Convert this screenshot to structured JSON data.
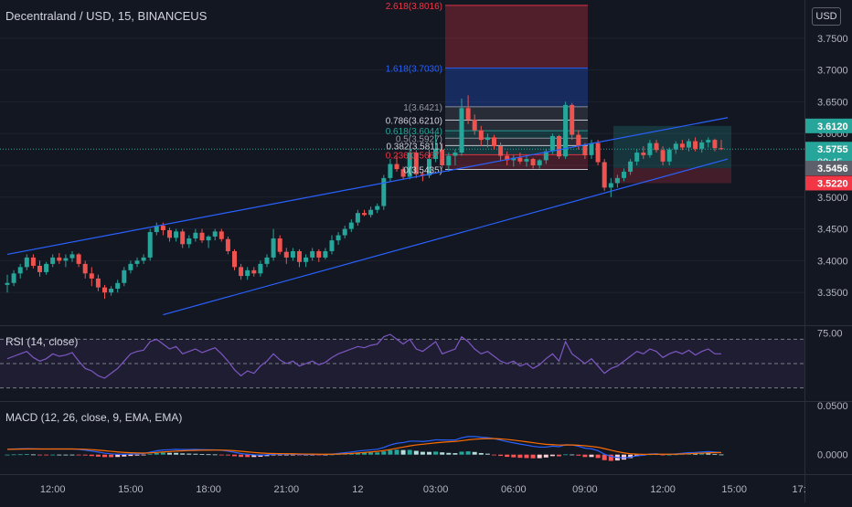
{
  "header": {
    "symbol_title": "Decentraland / USD, 15, BINANCEUS",
    "currency": "USD",
    "rsi_title": "RSI (14, close)",
    "macd_title": "MACD (12, 26, close, 9, EMA, EMA)"
  },
  "colors": {
    "background": "#131722",
    "up": "#26a69a",
    "down": "#ef5350",
    "channel": "#2962ff",
    "rsi_line": "#7e57c2",
    "macd_line": "#2962ff",
    "signal_line": "#ff6d00",
    "axis_text": "#b2b5be",
    "price_badge": "#26a69a",
    "low_badge": "#f23645",
    "gray_badge": "#5d606b"
  },
  "chart_data": {
    "type": "candlestick",
    "price_axis": {
      "range": [
        3.3,
        3.81
      ],
      "ticks": [
        "3.3500",
        "3.4000",
        "3.4500",
        "3.5000",
        "3.5500",
        "3.6000",
        "3.6500",
        "3.7000",
        "3.7500"
      ]
    },
    "time_axis": {
      "tick_labels": [
        "12:00",
        "15:00",
        "18:00",
        "21:00",
        "12",
        "03:00",
        "06:00",
        "09:00",
        "12:00",
        "15:00",
        "17:"
      ]
    },
    "candles": [
      [
        3.362,
        3.378,
        3.35,
        3.365
      ],
      [
        3.365,
        3.385,
        3.36,
        3.38
      ],
      [
        3.38,
        3.395,
        3.372,
        3.39
      ],
      [
        3.39,
        3.41,
        3.385,
        3.405
      ],
      [
        3.405,
        3.41,
        3.388,
        3.392
      ],
      [
        3.392,
        3.4,
        3.375,
        3.382
      ],
      [
        3.382,
        3.398,
        3.378,
        3.395
      ],
      [
        3.395,
        3.41,
        3.39,
        3.405
      ],
      [
        3.405,
        3.412,
        3.395,
        3.4
      ],
      [
        3.4,
        3.41,
        3.39,
        3.404
      ],
      [
        3.404,
        3.415,
        3.398,
        3.41
      ],
      [
        3.41,
        3.412,
        3.39,
        3.395
      ],
      [
        3.395,
        3.4,
        3.372,
        3.38
      ],
      [
        3.38,
        3.39,
        3.36,
        3.372
      ],
      [
        3.372,
        3.378,
        3.352,
        3.358
      ],
      [
        3.358,
        3.362,
        3.34,
        3.35
      ],
      [
        3.35,
        3.36,
        3.345,
        3.356
      ],
      [
        3.356,
        3.37,
        3.35,
        3.365
      ],
      [
        3.365,
        3.39,
        3.36,
        3.385
      ],
      [
        3.385,
        3.4,
        3.38,
        3.395
      ],
      [
        3.395,
        3.405,
        3.39,
        3.4
      ],
      [
        3.4,
        3.41,
        3.395,
        3.405
      ],
      [
        3.405,
        3.45,
        3.4,
        3.445
      ],
      [
        3.445,
        3.46,
        3.44,
        3.455
      ],
      [
        3.455,
        3.46,
        3.44,
        3.448
      ],
      [
        3.448,
        3.452,
        3.43,
        3.436
      ],
      [
        3.436,
        3.45,
        3.43,
        3.446
      ],
      [
        3.446,
        3.45,
        3.42,
        3.426
      ],
      [
        3.426,
        3.44,
        3.42,
        3.435
      ],
      [
        3.435,
        3.45,
        3.43,
        3.444
      ],
      [
        3.444,
        3.45,
        3.428,
        3.432
      ],
      [
        3.432,
        3.44,
        3.42,
        3.438
      ],
      [
        3.438,
        3.45,
        3.432,
        3.446
      ],
      [
        3.446,
        3.45,
        3.43,
        3.434
      ],
      [
        3.434,
        3.438,
        3.41,
        3.415
      ],
      [
        3.415,
        3.418,
        3.385,
        3.39
      ],
      [
        3.39,
        3.395,
        3.37,
        3.376
      ],
      [
        3.376,
        3.39,
        3.37,
        3.385
      ],
      [
        3.385,
        3.39,
        3.375,
        3.38
      ],
      [
        3.38,
        3.4,
        3.375,
        3.395
      ],
      [
        3.395,
        3.41,
        3.39,
        3.405
      ],
      [
        3.405,
        3.45,
        3.4,
        3.435
      ],
      [
        3.435,
        3.44,
        3.41,
        3.414
      ],
      [
        3.414,
        3.42,
        3.395,
        3.405
      ],
      [
        3.405,
        3.42,
        3.4,
        3.415
      ],
      [
        3.415,
        3.418,
        3.39,
        3.398
      ],
      [
        3.398,
        3.41,
        3.39,
        3.405
      ],
      [
        3.405,
        3.42,
        3.4,
        3.415
      ],
      [
        3.415,
        3.418,
        3.398,
        3.405
      ],
      [
        3.405,
        3.42,
        3.402,
        3.415
      ],
      [
        3.415,
        3.44,
        3.41,
        3.432
      ],
      [
        3.432,
        3.445,
        3.425,
        3.44
      ],
      [
        3.44,
        3.455,
        3.435,
        3.45
      ],
      [
        3.45,
        3.465,
        3.445,
        3.46
      ],
      [
        3.46,
        3.48,
        3.455,
        3.475
      ],
      [
        3.475,
        3.48,
        3.47,
        3.472
      ],
      [
        3.472,
        3.485,
        3.468,
        3.48
      ],
      [
        3.48,
        3.49,
        3.475,
        3.486
      ],
      [
        3.486,
        3.535,
        3.48,
        3.53
      ],
      [
        3.53,
        3.56,
        3.525,
        3.552
      ],
      [
        3.552,
        3.565,
        3.54,
        3.544
      ],
      [
        3.544,
        3.548,
        3.528,
        3.532
      ],
      [
        3.532,
        3.575,
        3.528,
        3.57
      ],
      [
        3.57,
        3.574,
        3.53,
        3.536
      ],
      [
        3.536,
        3.54,
        3.525,
        3.534
      ],
      [
        3.534,
        3.575,
        3.53,
        3.56
      ],
      [
        3.56,
        3.6,
        3.555,
        3.575
      ],
      [
        3.575,
        3.585,
        3.545,
        3.55
      ],
      [
        3.55,
        3.57,
        3.54,
        3.565
      ],
      [
        3.565,
        3.575,
        3.55,
        3.57
      ],
      [
        3.57,
        3.655,
        3.565,
        3.64
      ],
      [
        3.64,
        3.66,
        3.615,
        3.622
      ],
      [
        3.622,
        3.63,
        3.598,
        3.605
      ],
      [
        3.605,
        3.612,
        3.58,
        3.59
      ],
      [
        3.59,
        3.6,
        3.578,
        3.594
      ],
      [
        3.594,
        3.598,
        3.575,
        3.58
      ],
      [
        3.58,
        3.586,
        3.558,
        3.565
      ],
      [
        3.565,
        3.572,
        3.55,
        3.558
      ],
      [
        3.558,
        3.566,
        3.548,
        3.562
      ],
      [
        3.562,
        3.57,
        3.552,
        3.556
      ],
      [
        3.556,
        3.565,
        3.548,
        3.56
      ],
      [
        3.56,
        3.562,
        3.545,
        3.55
      ],
      [
        3.55,
        3.56,
        3.545,
        3.558
      ],
      [
        3.558,
        3.576,
        3.552,
        3.572
      ],
      [
        3.572,
        3.6,
        3.568,
        3.596
      ],
      [
        3.596,
        3.598,
        3.56,
        3.564
      ],
      [
        3.564,
        3.65,
        3.56,
        3.645
      ],
      [
        3.645,
        3.648,
        3.59,
        3.598
      ],
      [
        3.598,
        3.605,
        3.575,
        3.58
      ],
      [
        3.58,
        3.585,
        3.56,
        3.566
      ],
      [
        3.566,
        3.59,
        3.56,
        3.585
      ],
      [
        3.585,
        3.59,
        3.55,
        3.555
      ],
      [
        3.555,
        3.56,
        3.51,
        3.515
      ],
      [
        3.515,
        3.53,
        3.5,
        3.522
      ],
      [
        3.522,
        3.535,
        3.515,
        3.53
      ],
      [
        3.53,
        3.545,
        3.525,
        3.54
      ],
      [
        3.54,
        3.56,
        3.535,
        3.556
      ],
      [
        3.556,
        3.575,
        3.55,
        3.57
      ],
      [
        3.57,
        3.58,
        3.56,
        3.566
      ],
      [
        3.566,
        3.59,
        3.562,
        3.585
      ],
      [
        3.585,
        3.59,
        3.57,
        3.574
      ],
      [
        3.574,
        3.58,
        3.55,
        3.556
      ],
      [
        3.556,
        3.578,
        3.55,
        3.575
      ],
      [
        3.575,
        3.588,
        3.568,
        3.584
      ],
      [
        3.584,
        3.59,
        3.574,
        3.578
      ],
      [
        3.578,
        3.592,
        3.572,
        3.588
      ],
      [
        3.588,
        3.594,
        3.572,
        3.576
      ],
      [
        3.576,
        3.59,
        3.57,
        3.586
      ],
      [
        3.586,
        3.594,
        3.578,
        3.59
      ],
      [
        3.59,
        3.592,
        3.572,
        3.577
      ],
      [
        3.577,
        3.59,
        3.574,
        3.5755
      ]
    ],
    "channel": {
      "upper": [
        {
          "bar": 0,
          "price": 3.41
        },
        {
          "bar": 111,
          "price": 3.625
        }
      ],
      "lower": [
        {
          "bar": 24,
          "price": 3.315
        },
        {
          "bar": 111,
          "price": 3.56
        }
      ]
    },
    "fibonacci": {
      "levels": [
        {
          "label": "2.618(3.8016)",
          "price": 3.8016
        },
        {
          "label": "1.618(3.7030)",
          "price": 3.703
        },
        {
          "label": "1(3.6421)",
          "price": 3.6421
        },
        {
          "label": "0.786(3.6210)",
          "price": 3.621
        },
        {
          "label": "0.618(3.6044)",
          "price": 3.6044
        },
        {
          "label": "0.5(3.5927)",
          "price": 3.5927
        },
        {
          "label": "0.382(3.5811)",
          "price": 3.5811
        },
        {
          "label": "0.236(3.5667)",
          "price": 3.5667
        },
        {
          "label": "0(3.5435)",
          "price": 3.5435
        }
      ]
    },
    "position_box": {
      "target": 3.612,
      "entry": 3.5456,
      "stop": 3.522
    },
    "price_labels": [
      {
        "text": "3.6120",
        "price": 3.612,
        "role": "target"
      },
      {
        "text": "3.5755",
        "price": 3.5755,
        "role": "last",
        "countdown": "08:45"
      },
      {
        "text": "3.5456",
        "price": 3.5456,
        "role": "entry"
      },
      {
        "text": "3.5220",
        "price": 3.522,
        "role": "stop"
      }
    ],
    "rsi": {
      "range": [
        20,
        80
      ],
      "bands": [
        70,
        50,
        30
      ],
      "tick_labels": [
        "75.00"
      ],
      "values": [
        54,
        56,
        58,
        60,
        55,
        52,
        54,
        58,
        56,
        57,
        59,
        52,
        46,
        44,
        40,
        38,
        42,
        46,
        52,
        58,
        60,
        61,
        68,
        70,
        66,
        62,
        64,
        58,
        60,
        62,
        59,
        61,
        63,
        58,
        52,
        45,
        40,
        44,
        42,
        48,
        52,
        58,
        53,
        50,
        52,
        48,
        50,
        52,
        49,
        51,
        55,
        58,
        60,
        62,
        64,
        63,
        65,
        66,
        72,
        74,
        70,
        66,
        70,
        62,
        60,
        64,
        68,
        58,
        60,
        62,
        72,
        68,
        62,
        58,
        60,
        56,
        52,
        50,
        52,
        48,
        50,
        46,
        49,
        54,
        58,
        52,
        68,
        58,
        54,
        50,
        54,
        48,
        42,
        46,
        48,
        52,
        56,
        60,
        58,
        62,
        60,
        55,
        58,
        60,
        58,
        61,
        57,
        60,
        62,
        58,
        58
      ]
    },
    "macd": {
      "range": [
        -0.019,
        0.053
      ],
      "tick_labels": [
        "0.0000",
        "0.0500"
      ],
      "macd": [
        0.0055,
        0.0058,
        0.006,
        0.0062,
        0.006,
        0.0058,
        0.0057,
        0.0058,
        0.0058,
        0.0058,
        0.0058,
        0.0054,
        0.0046,
        0.0037,
        0.0026,
        0.0015,
        0.0008,
        0.0004,
        0.0004,
        0.0006,
        0.0008,
        0.0011,
        0.0026,
        0.0039,
        0.0047,
        0.005,
        0.0054,
        0.0052,
        0.0052,
        0.0053,
        0.0051,
        0.005,
        0.0049,
        0.0045,
        0.0036,
        0.0024,
        0.0011,
        0.0004,
        -0.0002,
        -0.0004,
        -0.0002,
        0.0004,
        0.0006,
        0.0005,
        0.0005,
        0.0002,
        0.0001,
        0.0002,
        0.0001,
        0.0002,
        0.0006,
        0.0012,
        0.0019,
        0.0027,
        0.0036,
        0.0043,
        0.0049,
        0.0055,
        0.0074,
        0.0099,
        0.0116,
        0.0124,
        0.0138,
        0.0138,
        0.0135,
        0.0141,
        0.0152,
        0.015,
        0.0149,
        0.015,
        0.0173,
        0.0185,
        0.0185,
        0.0178,
        0.0174,
        0.0164,
        0.0148,
        0.0133,
        0.0121,
        0.0108,
        0.0097,
        0.0085,
        0.0077,
        0.0077,
        0.0087,
        0.0081,
        0.0101,
        0.01,
        0.0086,
        0.0066,
        0.006,
        0.0041,
        0.0005,
        -0.0018,
        -0.0029,
        -0.0033,
        -0.0026,
        -0.0012,
        -0.0006,
        0.0007,
        0.0009,
        0.0001,
        0.0004,
        0.0008,
        0.0014,
        0.0021,
        0.0022,
        0.0028,
        0.0031,
        0.0027,
        0.0022
      ]
    }
  }
}
